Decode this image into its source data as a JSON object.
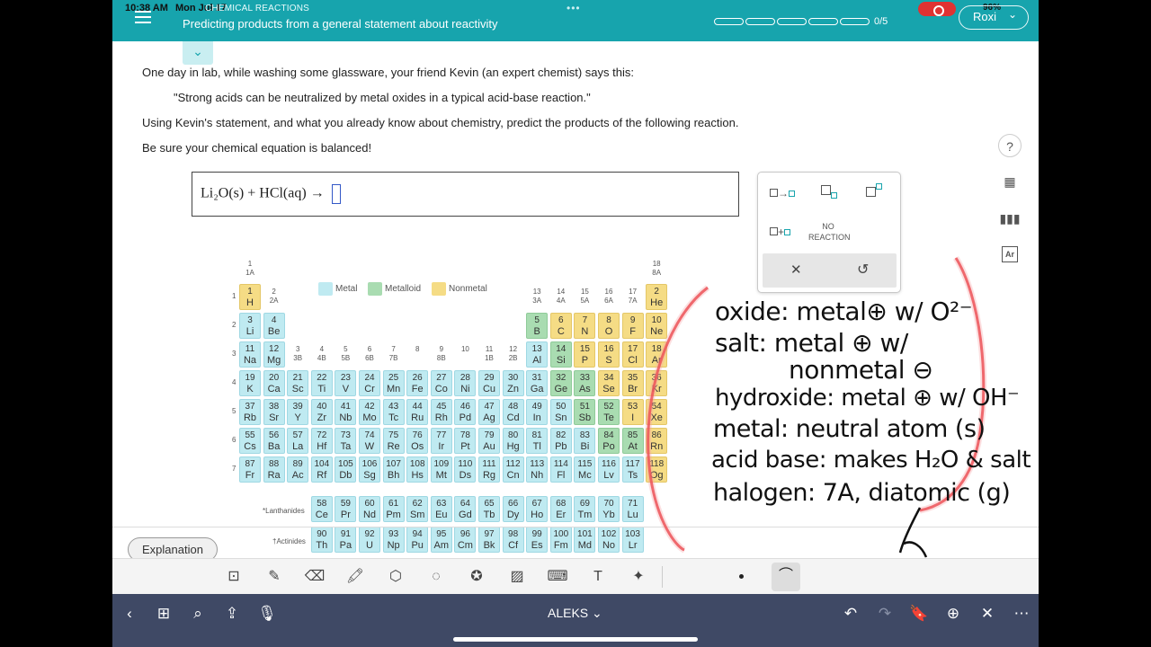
{
  "status": {
    "time": "10:38 AM",
    "date": "Mon Jul 17",
    "battery": "96%"
  },
  "header": {
    "section": "CHEMICAL REACTIONS",
    "title": "Predicting products from a general statement about reactivity",
    "progress_text": "0/5",
    "progress_total": 5,
    "progress_done": 0,
    "user": "Roxi"
  },
  "question": {
    "line1": "One day in lab, while washing some glassware, your friend Kevin (an expert chemist) says this:",
    "quote": "\"Strong acids can be neutralized by metal oxides in a typical acid-base reaction.\"",
    "line2": "Using Kevin's statement, and what you already know about chemistry, predict the products of the following reaction.",
    "line3": "Be sure your chemical equation is balanced!"
  },
  "equation": {
    "text": "Li₂O(s) + HCl(aq) →"
  },
  "palette": {
    "no_reaction": "NO REACTION"
  },
  "legend": {
    "metal": "Metal",
    "metalloid": "Metalloid",
    "nonmetal": "Nonmetal"
  },
  "periodic_table": {
    "elements": [
      [
        "1",
        "H",
        "n",
        1,
        1
      ],
      [
        "2",
        "He",
        "n",
        18,
        1
      ],
      [
        "3",
        "Li",
        "m",
        1,
        2
      ],
      [
        "4",
        "Be",
        "m",
        2,
        2
      ],
      [
        "5",
        "B",
        "d",
        13,
        2
      ],
      [
        "6",
        "C",
        "n",
        14,
        2
      ],
      [
        "7",
        "N",
        "n",
        15,
        2
      ],
      [
        "8",
        "O",
        "n",
        16,
        2
      ],
      [
        "9",
        "F",
        "n",
        17,
        2
      ],
      [
        "10",
        "Ne",
        "n",
        18,
        2
      ],
      [
        "11",
        "Na",
        "m",
        1,
        3
      ],
      [
        "12",
        "Mg",
        "m",
        2,
        3
      ],
      [
        "13",
        "Al",
        "m",
        13,
        3
      ],
      [
        "14",
        "Si",
        "d",
        14,
        3
      ],
      [
        "15",
        "P",
        "n",
        15,
        3
      ],
      [
        "16",
        "S",
        "n",
        16,
        3
      ],
      [
        "17",
        "Cl",
        "n",
        17,
        3
      ],
      [
        "18",
        "Ar",
        "n",
        18,
        3
      ],
      [
        "19",
        "K",
        "m",
        1,
        4
      ],
      [
        "20",
        "Ca",
        "m",
        2,
        4
      ],
      [
        "21",
        "Sc",
        "m",
        3,
        4
      ],
      [
        "22",
        "Ti",
        "m",
        4,
        4
      ],
      [
        "23",
        "V",
        "m",
        5,
        4
      ],
      [
        "24",
        "Cr",
        "m",
        6,
        4
      ],
      [
        "25",
        "Mn",
        "m",
        7,
        4
      ],
      [
        "26",
        "Fe",
        "m",
        8,
        4
      ],
      [
        "27",
        "Co",
        "m",
        9,
        4
      ],
      [
        "28",
        "Ni",
        "m",
        10,
        4
      ],
      [
        "29",
        "Cu",
        "m",
        11,
        4
      ],
      [
        "30",
        "Zn",
        "m",
        12,
        4
      ],
      [
        "31",
        "Ga",
        "m",
        13,
        4
      ],
      [
        "32",
        "Ge",
        "d",
        14,
        4
      ],
      [
        "33",
        "As",
        "d",
        15,
        4
      ],
      [
        "34",
        "Se",
        "n",
        16,
        4
      ],
      [
        "35",
        "Br",
        "n",
        17,
        4
      ],
      [
        "36",
        "Kr",
        "n",
        18,
        4
      ],
      [
        "37",
        "Rb",
        "m",
        1,
        5
      ],
      [
        "38",
        "Sr",
        "m",
        2,
        5
      ],
      [
        "39",
        "Y",
        "m",
        3,
        5
      ],
      [
        "40",
        "Zr",
        "m",
        4,
        5
      ],
      [
        "41",
        "Nb",
        "m",
        5,
        5
      ],
      [
        "42",
        "Mo",
        "m",
        6,
        5
      ],
      [
        "43",
        "Tc",
        "m",
        7,
        5
      ],
      [
        "44",
        "Ru",
        "m",
        8,
        5
      ],
      [
        "45",
        "Rh",
        "m",
        9,
        5
      ],
      [
        "46",
        "Pd",
        "m",
        10,
        5
      ],
      [
        "47",
        "Ag",
        "m",
        11,
        5
      ],
      [
        "48",
        "Cd",
        "m",
        12,
        5
      ],
      [
        "49",
        "In",
        "m",
        13,
        5
      ],
      [
        "50",
        "Sn",
        "m",
        14,
        5
      ],
      [
        "51",
        "Sb",
        "d",
        15,
        5
      ],
      [
        "52",
        "Te",
        "d",
        16,
        5
      ],
      [
        "53",
        "I",
        "n",
        17,
        5
      ],
      [
        "54",
        "Xe",
        "n",
        18,
        5
      ],
      [
        "55",
        "Cs",
        "m",
        1,
        6
      ],
      [
        "56",
        "Ba",
        "m",
        2,
        6
      ],
      [
        "57",
        "La",
        "m",
        3,
        6
      ],
      [
        "72",
        "Hf",
        "m",
        4,
        6
      ],
      [
        "73",
        "Ta",
        "m",
        5,
        6
      ],
      [
        "74",
        "W",
        "m",
        6,
        6
      ],
      [
        "75",
        "Re",
        "m",
        7,
        6
      ],
      [
        "76",
        "Os",
        "m",
        8,
        6
      ],
      [
        "77",
        "Ir",
        "m",
        9,
        6
      ],
      [
        "78",
        "Pt",
        "m",
        10,
        6
      ],
      [
        "79",
        "Au",
        "m",
        11,
        6
      ],
      [
        "80",
        "Hg",
        "m",
        12,
        6
      ],
      [
        "81",
        "Tl",
        "m",
        13,
        6
      ],
      [
        "82",
        "Pb",
        "m",
        14,
        6
      ],
      [
        "83",
        "Bi",
        "m",
        15,
        6
      ],
      [
        "84",
        "Po",
        "d",
        16,
        6
      ],
      [
        "85",
        "At",
        "d",
        17,
        6
      ],
      [
        "86",
        "Rn",
        "n",
        18,
        6
      ],
      [
        "87",
        "Fr",
        "m",
        1,
        7
      ],
      [
        "88",
        "Ra",
        "m",
        2,
        7
      ],
      [
        "89",
        "Ac",
        "m",
        3,
        7
      ],
      [
        "104",
        "Rf",
        "m",
        4,
        7
      ],
      [
        "105",
        "Db",
        "m",
        5,
        7
      ],
      [
        "106",
        "Sg",
        "m",
        6,
        7
      ],
      [
        "107",
        "Bh",
        "m",
        7,
        7
      ],
      [
        "108",
        "Hs",
        "m",
        8,
        7
      ],
      [
        "109",
        "Mt",
        "m",
        9,
        7
      ],
      [
        "110",
        "Ds",
        "m",
        10,
        7
      ],
      [
        "111",
        "Rg",
        "m",
        11,
        7
      ],
      [
        "112",
        "Cn",
        "m",
        12,
        7
      ],
      [
        "113",
        "Nh",
        "m",
        13,
        7
      ],
      [
        "114",
        "Fl",
        "m",
        14,
        7
      ],
      [
        "115",
        "Mc",
        "m",
        15,
        7
      ],
      [
        "116",
        "Lv",
        "m",
        16,
        7
      ],
      [
        "117",
        "Ts",
        "m",
        17,
        7
      ],
      [
        "118",
        "Og",
        "n",
        18,
        7
      ],
      [
        "58",
        "Ce",
        "m",
        4,
        9
      ],
      [
        "59",
        "Pr",
        "m",
        5,
        9
      ],
      [
        "60",
        "Nd",
        "m",
        6,
        9
      ],
      [
        "61",
        "Pm",
        "m",
        7,
        9
      ],
      [
        "62",
        "Sm",
        "m",
        8,
        9
      ],
      [
        "63",
        "Eu",
        "m",
        9,
        9
      ],
      [
        "64",
        "Gd",
        "m",
        10,
        9
      ],
      [
        "65",
        "Tb",
        "m",
        11,
        9
      ],
      [
        "66",
        "Dy",
        "m",
        12,
        9
      ],
      [
        "67",
        "Ho",
        "m",
        13,
        9
      ],
      [
        "68",
        "Er",
        "m",
        14,
        9
      ],
      [
        "69",
        "Tm",
        "m",
        15,
        9
      ],
      [
        "70",
        "Yb",
        "m",
        16,
        9
      ],
      [
        "71",
        "Lu",
        "m",
        17,
        9
      ],
      [
        "90",
        "Th",
        "m",
        4,
        10
      ],
      [
        "91",
        "Pa",
        "m",
        5,
        10
      ],
      [
        "92",
        "U",
        "m",
        6,
        10
      ],
      [
        "93",
        "Np",
        "m",
        7,
        10
      ],
      [
        "94",
        "Pu",
        "m",
        8,
        10
      ],
      [
        "95",
        "Am",
        "m",
        9,
        10
      ],
      [
        "96",
        "Cm",
        "m",
        10,
        10
      ],
      [
        "97",
        "Bk",
        "m",
        11,
        10
      ],
      [
        "98",
        "Cf",
        "m",
        12,
        10
      ],
      [
        "99",
        "Es",
        "m",
        13,
        10
      ],
      [
        "100",
        "Fm",
        "m",
        14,
        10
      ],
      [
        "101",
        "Md",
        "m",
        15,
        10
      ],
      [
        "102",
        "No",
        "m",
        16,
        10
      ],
      [
        "103",
        "Lr",
        "m",
        17,
        10
      ]
    ],
    "group_labels": [
      [
        "1",
        "1A",
        1
      ],
      [
        "2",
        "2A",
        2
      ],
      [
        "3",
        "3B",
        3
      ],
      [
        "4",
        "4B",
        4
      ],
      [
        "5",
        "5B",
        5
      ],
      [
        "6",
        "6B",
        6
      ],
      [
        "7",
        "7B",
        7
      ],
      [
        "8",
        "",
        8
      ],
      [
        "9",
        "8B",
        9
      ],
      [
        "10",
        "",
        10
      ],
      [
        "11",
        "1B",
        11
      ],
      [
        "12",
        "2B",
        12
      ],
      [
        "13",
        "3A",
        13
      ],
      [
        "14",
        "4A",
        14
      ],
      [
        "15",
        "5A",
        15
      ],
      [
        "16",
        "6A",
        16
      ],
      [
        "17",
        "7A",
        17
      ],
      [
        "18",
        "8A",
        18
      ]
    ],
    "periods": [
      "1",
      "2",
      "3",
      "4",
      "5",
      "6",
      "7"
    ],
    "lanthanides_label": "*Lanthanides",
    "actinides_label": "†Actinides"
  },
  "explanation": "Explanation",
  "nav": {
    "title": "ALEKS ⌄"
  },
  "handwriting": [
    "oxide: metal⊕ w/ O²⁻",
    "salt: metal ⊕ w/",
    "nonmetal ⊖",
    "hydroxide: metal ⊕ w/ OH⁻",
    "metal: neutral atom (s)",
    "acid base: makes H₂O & salt",
    "halogen: 7A, diatomic (g)"
  ]
}
